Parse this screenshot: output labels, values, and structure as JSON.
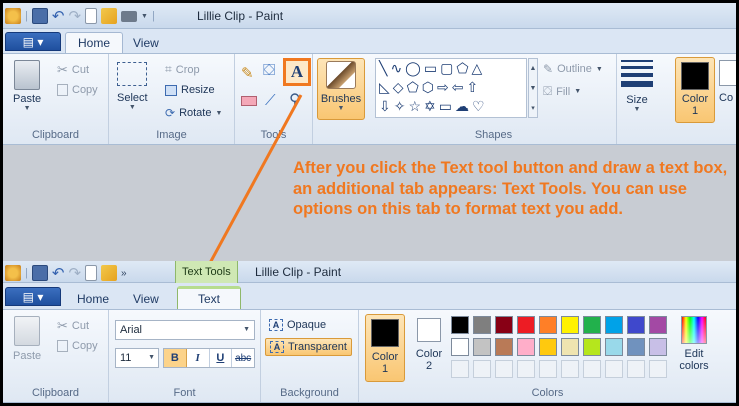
{
  "colors": {
    "accent_orange": "#f07820",
    "ribbon_blue": "#1f4f9e",
    "contextual_green": "#cfe8b4"
  },
  "top": {
    "title": "Lillie Clip - Paint",
    "file_label": "▤ ▾",
    "tabs": [
      {
        "label": "Home",
        "active": true
      },
      {
        "label": "View",
        "active": false
      }
    ],
    "clipboard": {
      "paste": "Paste",
      "cut": "Cut",
      "copy": "Copy",
      "label": "Clipboard"
    },
    "image": {
      "select": "Select",
      "crop": "Crop",
      "resize": "Resize",
      "rotate": "Rotate",
      "label": "Image"
    },
    "tools": {
      "label": "Tools"
    },
    "brushes": {
      "label": "Brushes"
    },
    "shapes": {
      "label": "Shapes",
      "outline": "Outline",
      "fill": "Fill"
    },
    "size": {
      "label": "Size"
    },
    "color1": {
      "line1": "Color",
      "line2": "1"
    },
    "color2": {
      "label": "Co"
    }
  },
  "callout": {
    "text": "After you click the Text tool button and draw a text box, an additional tab appears: Text Tools. You can use options on this tab to format text you add."
  },
  "bottom": {
    "contextual_tab": "Text Tools",
    "title": "Lillie Clip - Paint",
    "file_label": "▤ ▾",
    "tabs": [
      {
        "label": "Home",
        "active": false
      },
      {
        "label": "View",
        "active": false
      },
      {
        "label": "Text",
        "active": true
      }
    ],
    "clipboard": {
      "paste": "Paste",
      "cut": "Cut",
      "copy": "Copy",
      "label": "Clipboard"
    },
    "font": {
      "family": "Arial",
      "size": "11",
      "bold": "B",
      "italic": "I",
      "underline": "U",
      "strike": "abc",
      "label": "Font"
    },
    "background": {
      "opaque": "Opaque",
      "transparent": "Transparent",
      "label": "Background"
    },
    "colors": {
      "color1_line1": "Color",
      "color1_line2": "1",
      "color2_line1": "Color",
      "color2_line2": "2",
      "edit_line1": "Edit",
      "edit_line2": "colors",
      "label": "Colors",
      "palette_row1": [
        "#000000",
        "#7f7f7f",
        "#880015",
        "#ed1c24",
        "#ff7f27",
        "#fff200",
        "#22b14c",
        "#00a2e8",
        "#3f48cc",
        "#a349a4"
      ],
      "palette_row2": [
        "#ffffff",
        "#c3c3c3",
        "#b97a57",
        "#ffaec9",
        "#ffc90e",
        "#efe4b0",
        "#b5e61d",
        "#99d9ea",
        "#7092be",
        "#c8bfe7"
      ]
    }
  }
}
